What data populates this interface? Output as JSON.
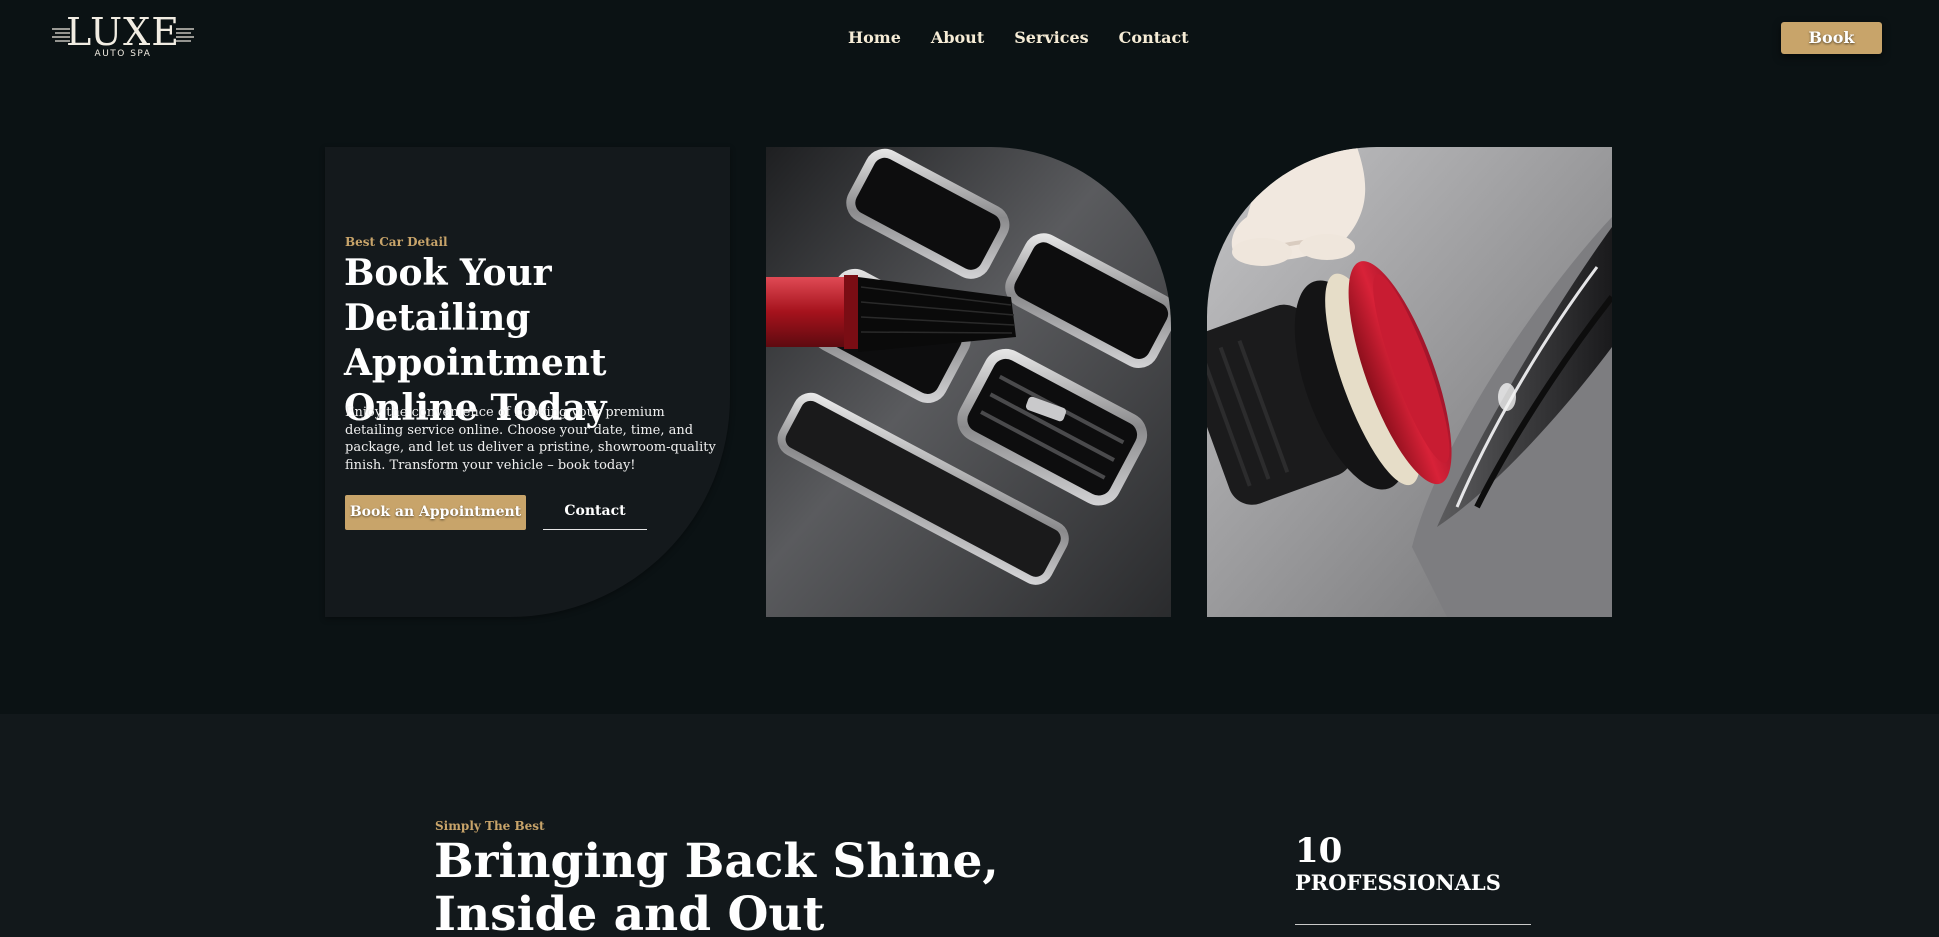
{
  "brand": {
    "logo_text": "LUXE",
    "logo_subtext": "AUTO SPA"
  },
  "nav": {
    "items": [
      "Home",
      "About",
      "Services",
      "Contact"
    ]
  },
  "header": {
    "book_label": "Book"
  },
  "hero": {
    "eyebrow": "Best Car Detail",
    "title_lines": [
      "Book Your Detailing",
      "Appointment",
      "Online Today"
    ],
    "description": "Enjoy the convenience of booking your premium detailing service online. Choose your date, time, and package, and let us deliver a pristine, showroom-quality finish. Transform your vehicle – book today!",
    "primary_button": "Book an Appointment",
    "secondary_button": "Contact"
  },
  "section2": {
    "eyebrow": "Simply The Best",
    "title_lines": [
      "Bringing Back Shine,",
      "Inside and Out"
    ],
    "stat": {
      "number": "10",
      "label": "PROFESSIONALS"
    }
  },
  "colors": {
    "background": "#0b1214",
    "accent_gold": "#c8a46a",
    "card": "#14191c",
    "section_bg": "#12181b"
  }
}
